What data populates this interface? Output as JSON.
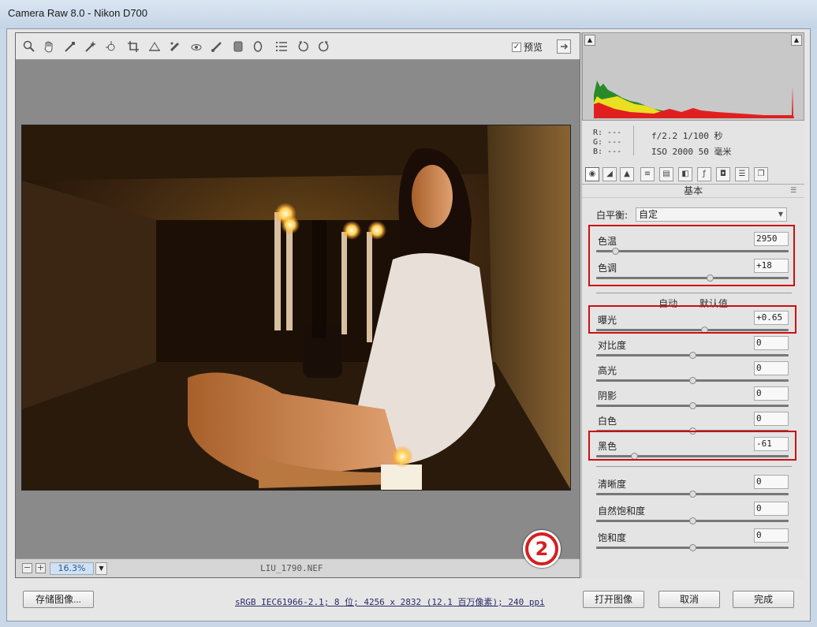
{
  "window": {
    "title": "Camera Raw 8.0 -  Nikon D700"
  },
  "toolbar": {
    "tools": [
      "zoom-tool-icon",
      "hand-tool-icon",
      "white-balance-tool-icon",
      "color-sampler-icon",
      "targeted-adjustment-icon",
      "crop-tool-icon",
      "straighten-tool-icon",
      "spot-removal-icon",
      "red-eye-icon",
      "adjustment-brush-icon",
      "graduated-filter-icon",
      "radial-filter-icon",
      "preferences-icon",
      "rotate-left-icon",
      "rotate-right-icon"
    ],
    "preview_label": "预览",
    "preview_checked": "✓"
  },
  "status": {
    "zoom_minus": "−",
    "zoom_plus": "+",
    "zoom": "16.3%",
    "filename": "LIU_1790.NEF"
  },
  "histogram": {
    "rgb": "R: ---\nG: ---\nB: ---",
    "aperture_shutter": "f/2.2  1/100 秒",
    "iso_focal": "ISO 2000  50 毫米"
  },
  "panel": {
    "title": "基本",
    "wb_label": "白平衡:",
    "wb_value": "自定",
    "auto": "自动",
    "default": "默认值",
    "sliders": [
      {
        "label": "色温",
        "value": "2950",
        "pos": 0.1
      },
      {
        "label": "色调",
        "value": "+18",
        "pos": 0.59
      },
      {
        "label": "曝光",
        "value": "+0.65",
        "pos": 0.56
      },
      {
        "label": "对比度",
        "value": "0",
        "pos": 0.5
      },
      {
        "label": "高光",
        "value": "0",
        "pos": 0.5
      },
      {
        "label": "阴影",
        "value": "0",
        "pos": 0.5
      },
      {
        "label": "白色",
        "value": "0",
        "pos": 0.5
      },
      {
        "label": "黑色",
        "value": "-61",
        "pos": 0.195
      },
      {
        "label": "清晰度",
        "value": "0",
        "pos": 0.5
      },
      {
        "label": "自然饱和度",
        "value": "0",
        "pos": 0.5
      },
      {
        "label": "饱和度",
        "value": "0",
        "pos": 0.5
      }
    ]
  },
  "bottom": {
    "save_label": "存储图像...",
    "workflow": "sRGB IEC61966-2.1; 8 位; 4256 x 2832 (12.1 百万像素); 240 ppi",
    "open_label": "打开图像",
    "cancel_label": "取消",
    "done_label": "完成",
    "callout": "2"
  },
  "colors": {
    "highlight_box": "#cc1010",
    "callout": "#d42020"
  }
}
